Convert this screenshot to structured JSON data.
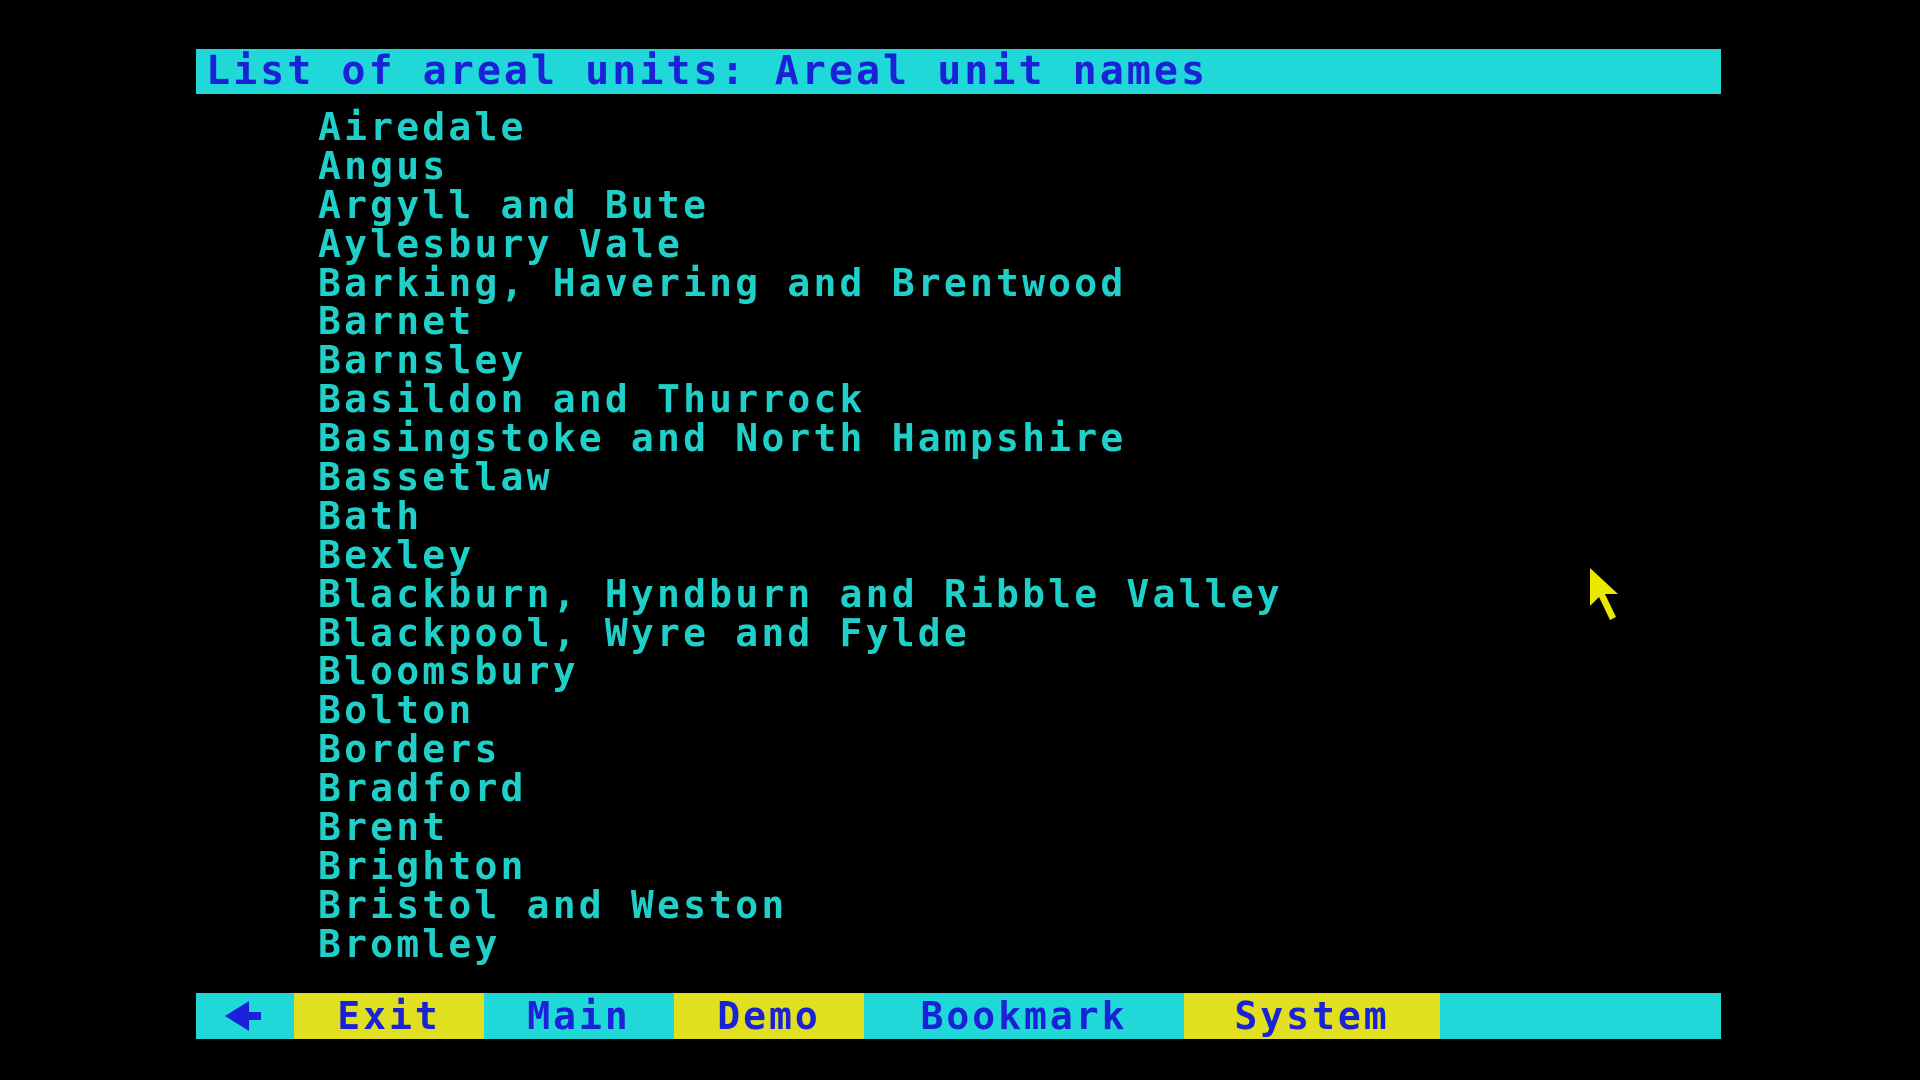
{
  "header": {
    "title": "List of areal units: Areal unit names"
  },
  "units": [
    "Airedale",
    "Angus",
    "Argyll and Bute",
    "Aylesbury Vale",
    "Barking, Havering and Brentwood",
    "Barnet",
    "Barnsley",
    "Basildon and Thurrock",
    "Basingstoke and North Hampshire",
    "Bassetlaw",
    "Bath",
    "Bexley",
    "Blackburn, Hyndburn and Ribble Valley",
    "Blackpool, Wyre and Fylde",
    "Bloomsbury",
    "Bolton",
    "Borders",
    "Bradford",
    "Brent",
    "Brighton",
    "Bristol and Weston",
    "Bromley"
  ],
  "footer": {
    "back_icon": "back-arrow-icon",
    "exit_label": "Exit",
    "main_label": "Main",
    "demo_label": "Demo",
    "bookmark_label": "Bookmark",
    "system_label": "System"
  },
  "colors": {
    "background": "#000000",
    "bar_cyan": "#20d8d8",
    "bar_yellow": "#e0e020",
    "bar_text_blue": "#1a22d8",
    "list_text_cyan": "#20d0c8",
    "cursor_yellow": "#e8e800"
  },
  "cursor": {
    "icon": "mouse-pointer-icon"
  }
}
